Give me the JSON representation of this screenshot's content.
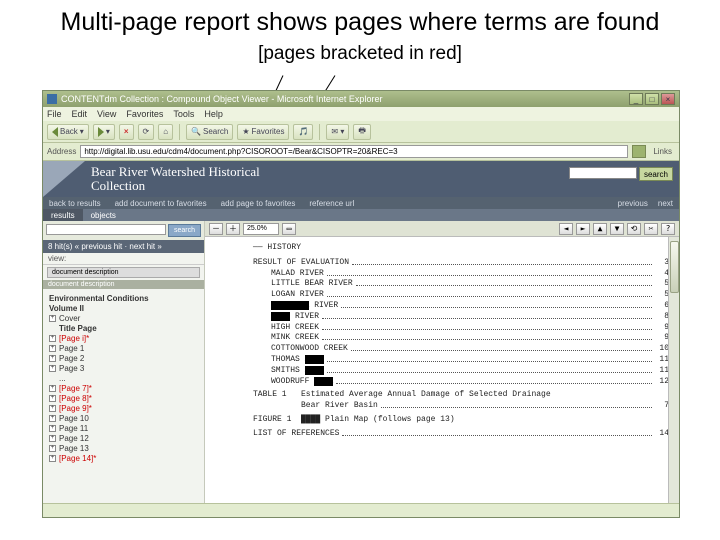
{
  "slide": {
    "heading": "Multi-page report shows pages where terms are found",
    "sub": "[pages bracketed in red]"
  },
  "window": {
    "title": "CONTENTdm Collection : Compound Object Viewer - Microsoft Internet Explorer",
    "min": "_",
    "max": "□",
    "close": "×"
  },
  "menu": {
    "file": "File",
    "edit": "Edit",
    "view": "View",
    "favorites": "Favorites",
    "tools": "Tools",
    "help": "Help"
  },
  "toolbar": {
    "back": "Back",
    "fwd": "",
    "stop": "×",
    "refresh": "⟳",
    "home": "⌂",
    "search": "Search",
    "favorites": "Favorites",
    "media": ""
  },
  "address": {
    "label": "Address",
    "url": "http://digital.lib.usu.edu/cdm4/document.php?CISOROOT=/Bear&CISOPTR=20&REC=3",
    "go": "Go",
    "links": "Links"
  },
  "banner": {
    "title_l1": "Bear River Watershed Historical",
    "title_l2": "Collection",
    "search_btn": "search"
  },
  "linkrow": {
    "back": "back to results",
    "add_doc": "add document to favorites",
    "add_page": "add page to favorites",
    "ref": "reference url",
    "prev": "previous",
    "next": "next"
  },
  "tabs": {
    "t1": "results",
    "t2": "objects"
  },
  "left": {
    "hits_label": "8 hit(s)    « previous hit · next hit »",
    "search_btn": "search",
    "view_label": "view:",
    "dd": "document description",
    "tree_hdr": "document description",
    "vol_l1": "Environmental Conditions",
    "vol_l2": "Volume II",
    "items": [
      {
        "pm": "+",
        "label": "Cover",
        "red": false
      },
      {
        "pm": "",
        "label": "Title Page",
        "red": false,
        "bold": true
      },
      {
        "pm": "+",
        "label": "[Page i]*",
        "red": true
      },
      {
        "pm": "+",
        "label": "Page 1",
        "red": false
      },
      {
        "pm": "+",
        "label": "Page 2",
        "red": false
      },
      {
        "pm": "+",
        "label": "Page 3",
        "red": false
      },
      {
        "pm": "",
        "label": "...",
        "red": false
      },
      {
        "pm": "+",
        "label": "[Page 7]*",
        "red": true
      },
      {
        "pm": "+",
        "label": "[Page 8]*",
        "red": true
      },
      {
        "pm": "+",
        "label": "[Page 9]*",
        "red": true
      },
      {
        "pm": "+",
        "label": "Page 10",
        "red": false
      },
      {
        "pm": "+",
        "label": "Page 11",
        "red": false
      },
      {
        "pm": "+",
        "label": "Page 12",
        "red": false
      },
      {
        "pm": "+",
        "label": "Page 13",
        "red": false
      },
      {
        "pm": "+",
        "label": "[Page 14]*",
        "red": true
      }
    ]
  },
  "viewer": {
    "zoom": "25.0%"
  },
  "doc": {
    "hdr": "—— HISTORY",
    "result": "RESULT OF EVALUATION",
    "rows": [
      {
        "t": "MALAD RIVER",
        "n": "4"
      },
      {
        "t": "LITTLE BEAR RIVER",
        "n": "5"
      },
      {
        "t": "LOGAN RIVER",
        "n": "5"
      },
      {
        "t": "████████ RIVER",
        "n": "6"
      },
      {
        "t": "████ RIVER",
        "n": "8"
      },
      {
        "t": "HIGH CREEK",
        "n": "9"
      },
      {
        "t": "MINK CREEK",
        "n": "9"
      },
      {
        "t": "COTTONWOOD CREEK",
        "n": "10"
      },
      {
        "t": "THOMAS ████",
        "n": "11"
      },
      {
        "t": "SMITHS ████",
        "n": "11"
      },
      {
        "t": "WOODRUFF ████",
        "n": "12"
      }
    ],
    "table_line": "TABLE 1   Estimated Average Annual Damage of Selected Drainage",
    "table_line2": "          Bear River Basin",
    "table_n": "7",
    "fig_line": "FIGURE 1  ████ Plain Map (follows page 13)",
    "ref_line": "LIST OF REFERENCES",
    "ref_n": "14"
  },
  "status": {
    "text": ""
  }
}
